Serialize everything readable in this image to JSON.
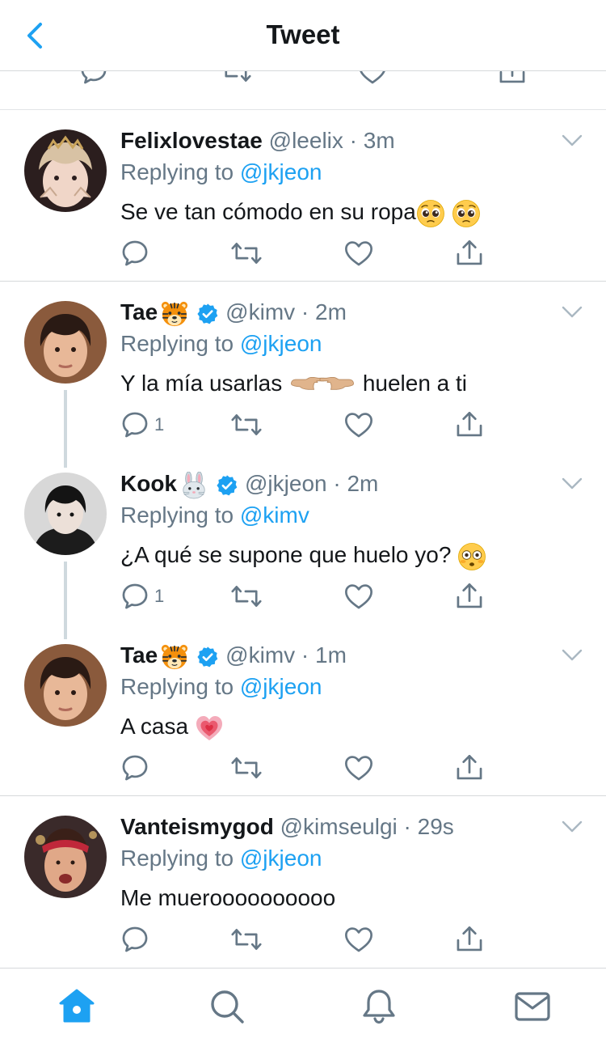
{
  "header": {
    "title": "Tweet"
  },
  "colors": {
    "accent": "#1da1f2",
    "text": "#14171a",
    "muted": "#657786",
    "verified": "#1da1f2",
    "divider": "#d6d9db"
  },
  "tweets": [
    {
      "name": "Felixlovestae",
      "handle": "@leelix",
      "time": "3m",
      "reply_prefix": "Replying to",
      "reply_to": "@jkjeon",
      "text": "Se ve tan cómodo en su ropa",
      "text_emoji": "pleading-face-emoji x2",
      "reply_count": "",
      "verified": false
    },
    {
      "name": "Tae",
      "name_emoji": "tiger-face-emoji",
      "handle": "@kimv",
      "time": "2m",
      "reply_prefix": "Replying to",
      "reply_to": "@jkjeon",
      "text_before": "Y la mía usarlas",
      "text_after": "huelen a ti",
      "text_emoji": "pointing-fingers-emoji",
      "reply_count": "1",
      "verified": true
    },
    {
      "name": "Kook",
      "name_emoji": "rabbit-face-emoji",
      "handle": "@jkjeon",
      "time": "2m",
      "reply_prefix": "Replying to",
      "reply_to": "@kimv",
      "text": "¿A qué se supone que huelo yo?",
      "text_emoji": "flushed-face-emoji",
      "reply_count": "1",
      "verified": true
    },
    {
      "name": "Tae",
      "name_emoji": "tiger-face-emoji",
      "handle": "@kimv",
      "time": "1m",
      "reply_prefix": "Replying to",
      "reply_to": "@jkjeon",
      "text": "A casa",
      "text_emoji": "growing-heart-emoji",
      "reply_count": "",
      "verified": true
    },
    {
      "name": "Vanteismygod",
      "handle": "@kimseulgi",
      "time": "29s",
      "reply_prefix": "Replying to",
      "reply_to": "@jkjeon",
      "text": "Me mueroooooooooo",
      "reply_count": "",
      "verified": false
    }
  ],
  "tabbar": {
    "items": [
      "home-icon",
      "search-icon",
      "notifications-icon",
      "messages-icon"
    ],
    "active": "home-icon"
  }
}
